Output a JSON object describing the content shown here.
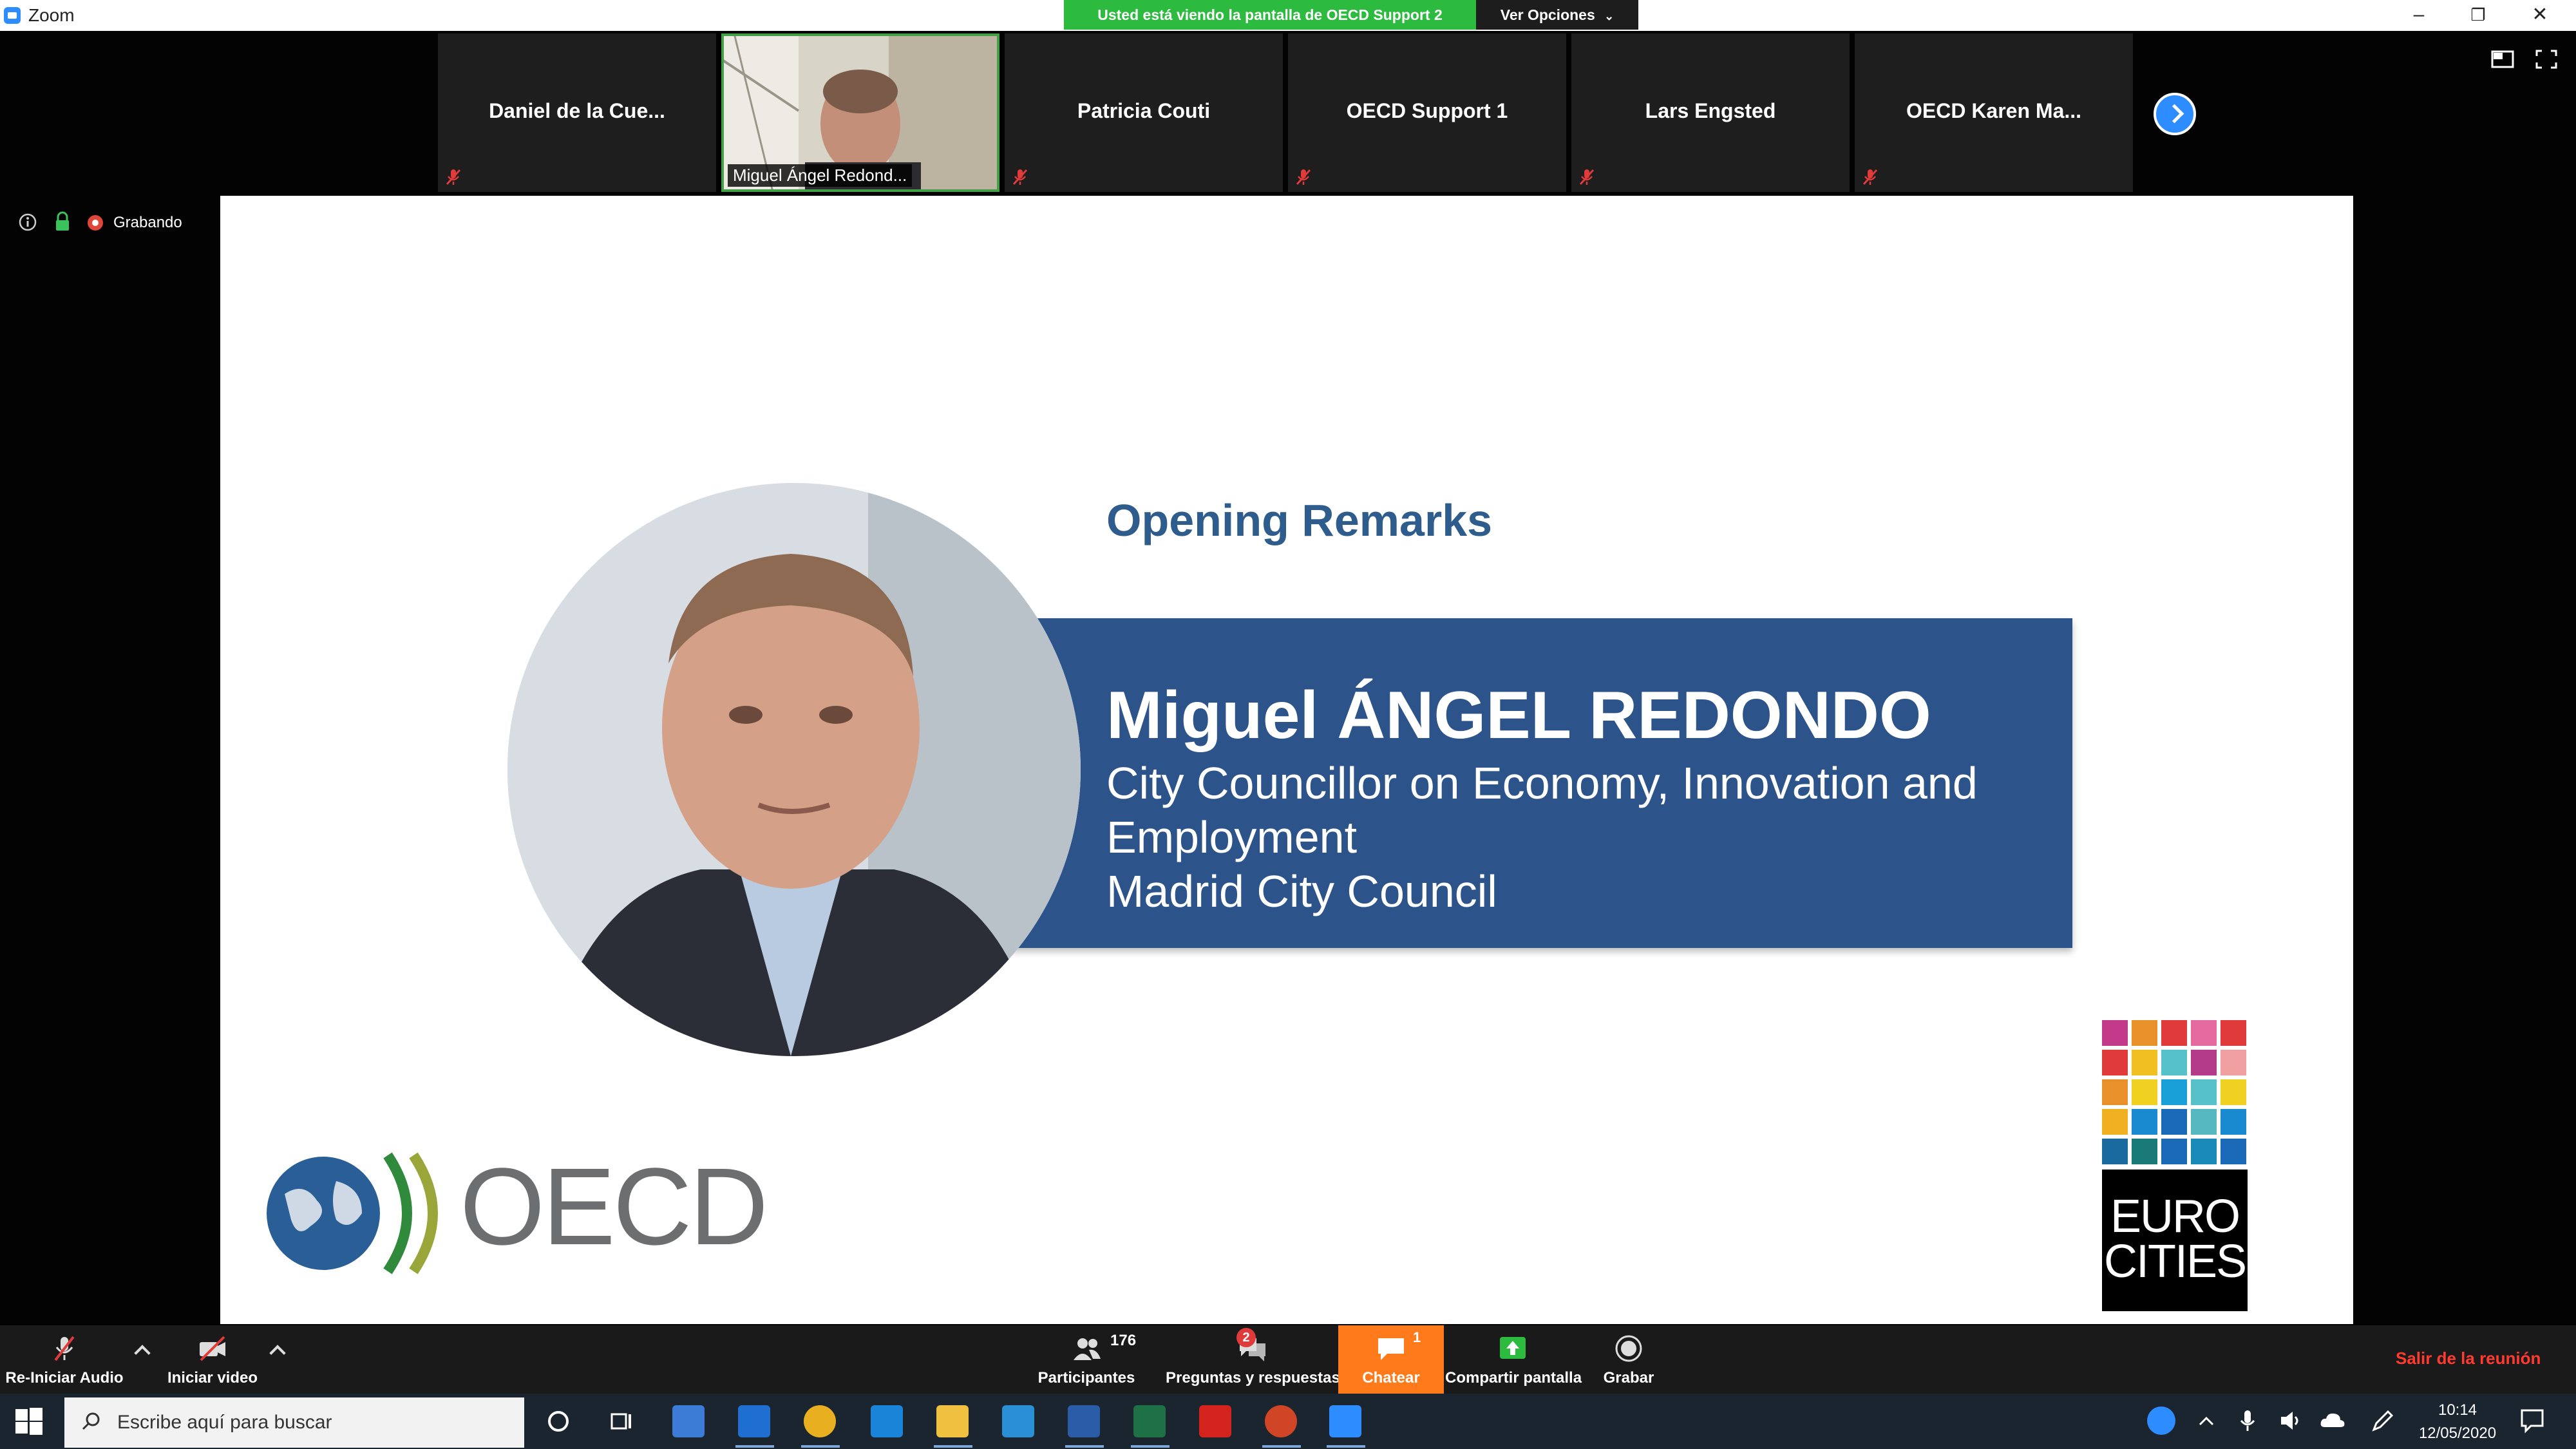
{
  "window": {
    "app_title": "Zoom",
    "share_banner": "Usted está viendo la pantalla de OECD Support 2",
    "view_options": "Ver Opciones",
    "minimize": "–",
    "restore": "❐",
    "close": "✕"
  },
  "participants": [
    {
      "name": "Daniel de la Cue...",
      "muted": true
    },
    {
      "name": "Miguel Ángel Redond...",
      "muted": false,
      "video": true
    },
    {
      "name": "Patricia Couti",
      "muted": true
    },
    {
      "name": "OECD Support 1",
      "muted": true
    },
    {
      "name": "Lars Engsted",
      "muted": true
    },
    {
      "name": "OECD Karen Ma...",
      "muted": true
    }
  ],
  "meeting_status": {
    "recording": "Grabando"
  },
  "slide": {
    "heading": "Opening Remarks",
    "speaker_name": "Miguel ÁNGEL REDONDO",
    "role_line_1": "City Councillor on Economy, Innovation and",
    "role_line_2": "Employment",
    "role_line_3": "Madrid City Council",
    "oecd_logo_text": "OECD",
    "eurocities_line_1": "EURO",
    "eurocities_line_2": "CITIES"
  },
  "toolbar": {
    "audio": "Re-Iniciar Audio",
    "video": "Iniciar video",
    "participants": "Participantes",
    "participants_count": "176",
    "qa": "Preguntas y respuestas",
    "qa_badge": "2",
    "chat": "Chatear",
    "chat_badge": "1",
    "share": "Compartir pantalla",
    "record": "Grabar",
    "leave": "Salir de la reunión"
  },
  "taskbar": {
    "search_placeholder": "Escribe aquí para buscar",
    "time": "10:14",
    "date": "12/05/2020"
  },
  "colors": {
    "slide_band": "#2c548a",
    "heading": "#2e5c8c",
    "share_banner": "#2dbb3f",
    "chat_active": "#ff7a1a",
    "leave": "#ff3b30"
  }
}
